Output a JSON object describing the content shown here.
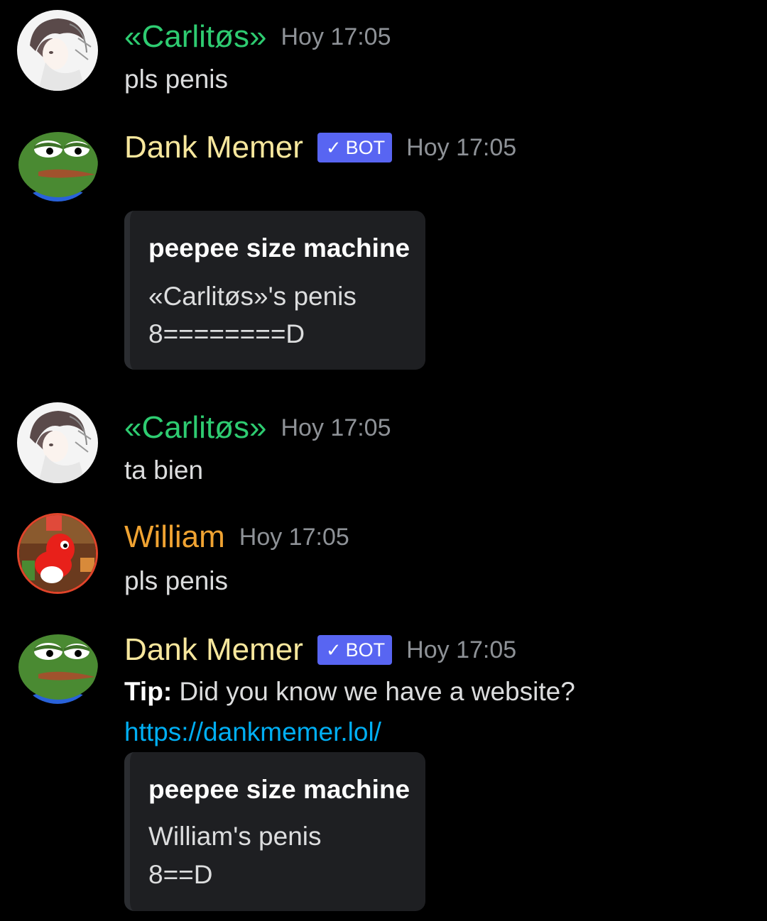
{
  "messages": [
    {
      "author": "«Carlitøs»",
      "time": "Hoy 17:05",
      "text": "pls penis"
    },
    {
      "author": "Dank Memer",
      "bot_tag": "BOT",
      "bot_check": "✓",
      "time": "Hoy 17:05",
      "embed": {
        "title": "peepee size machine",
        "line1": "«Carlitøs»'s penis",
        "line2": "8========D"
      }
    },
    {
      "author": "«Carlitøs»",
      "time": "Hoy 17:05",
      "text": "ta bien"
    },
    {
      "author": "William",
      "time": "Hoy 17:05",
      "text": "pls penis"
    },
    {
      "author": "Dank Memer",
      "bot_tag": "BOT",
      "bot_check": "✓",
      "time": "Hoy 17:05",
      "tip_label": "Tip:",
      "tip_text": "Did you know we have a website?",
      "link": "https://dankmemer.lol/",
      "embed": {
        "title": "peepee size machine",
        "line1": "William's penis",
        "line2": "8==D"
      }
    }
  ],
  "avatars": {
    "carlitos": "anime-avatar-icon",
    "dank": "pepe-frog-avatar-icon",
    "william": "yoshi-avatar-icon"
  },
  "colors": {
    "background": "#000000",
    "carlitos_name": "#2ecc71",
    "dank_name": "#f7e79d",
    "william_name": "#f0a332",
    "bot_tag": "#5865f2",
    "link": "#00aff4",
    "embed_bg": "#1e1f22"
  }
}
